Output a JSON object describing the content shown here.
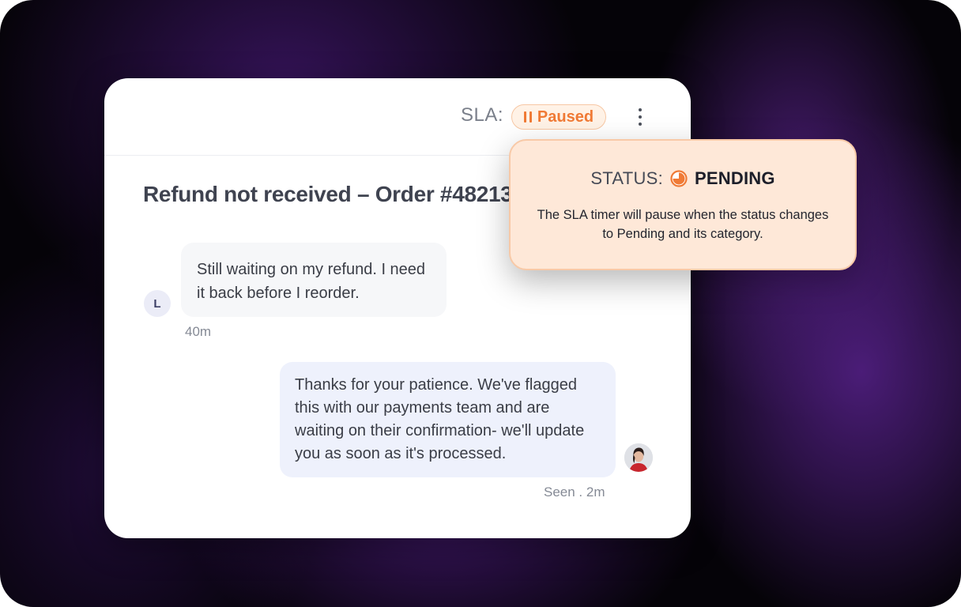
{
  "header": {
    "sla_label": "SLA:",
    "sla_status": "Paused",
    "more_icon": "kebab-menu-icon"
  },
  "ticket": {
    "title": "Refund not received – Order #48213"
  },
  "messages": [
    {
      "direction": "incoming",
      "avatar_initial": "L",
      "text": "Still waiting on my refund. I need it back before I reorder.",
      "time": "40m"
    },
    {
      "direction": "outgoing",
      "text": "Thanks for your patience. We've flagged this with our payments team and are waiting on their confirmation- we'll update you as soon as it's processed.",
      "meta": "Seen . 2m"
    }
  ],
  "status_popover": {
    "label": "STATUS:",
    "value": "PENDING",
    "icon": "pending-pie-icon",
    "description": "The SLA timer will pause when the status changes to Pending and its category."
  },
  "colors": {
    "accent_orange": "#f07a35",
    "popover_bg": "#fee8d8",
    "outgoing_bubble": "#eef1fc",
    "incoming_bubble": "#f6f7f9"
  }
}
